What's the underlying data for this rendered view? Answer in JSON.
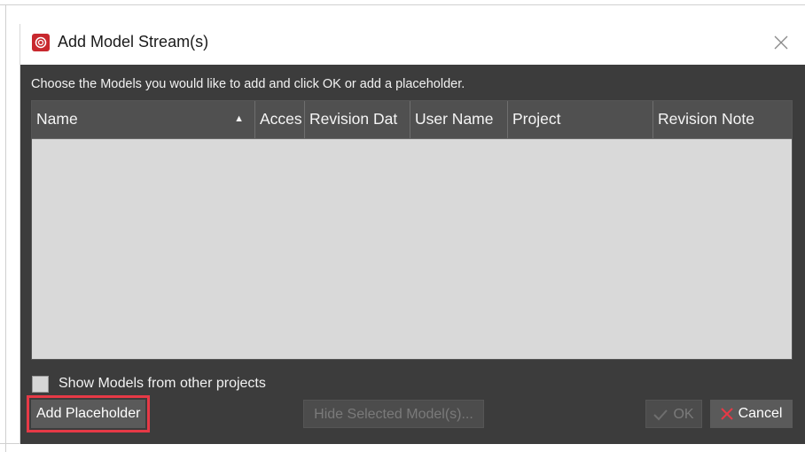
{
  "dialog": {
    "title": "Add Model Stream(s)",
    "app_icon": "revit-cloud-icon",
    "close_icon": "close-icon"
  },
  "instruction": "Choose the Models you would like to add and click OK or add a placeholder.",
  "table": {
    "columns": [
      {
        "label": "Name",
        "sorted": "ascending"
      },
      {
        "label": "Acces"
      },
      {
        "label": "Revision Dat"
      },
      {
        "label": "User Name"
      },
      {
        "label": "Project"
      },
      {
        "label": "Revision Note"
      }
    ],
    "rows": []
  },
  "options": {
    "show_other_projects_label": "Show Models from other projects",
    "show_other_projects_checked": false
  },
  "buttons": {
    "add_placeholder": "Add Placeholder",
    "hide_selected": "Hide Selected Model(s)...",
    "ok": "OK",
    "cancel": "Cancel"
  },
  "colors": {
    "dialog_body": "#3c3c3c",
    "table_header": "#505050",
    "table_body": "#d9d9d9",
    "highlight": "#e63946",
    "cancel_icon": "#e63946",
    "app_icon": "#c8282e"
  }
}
